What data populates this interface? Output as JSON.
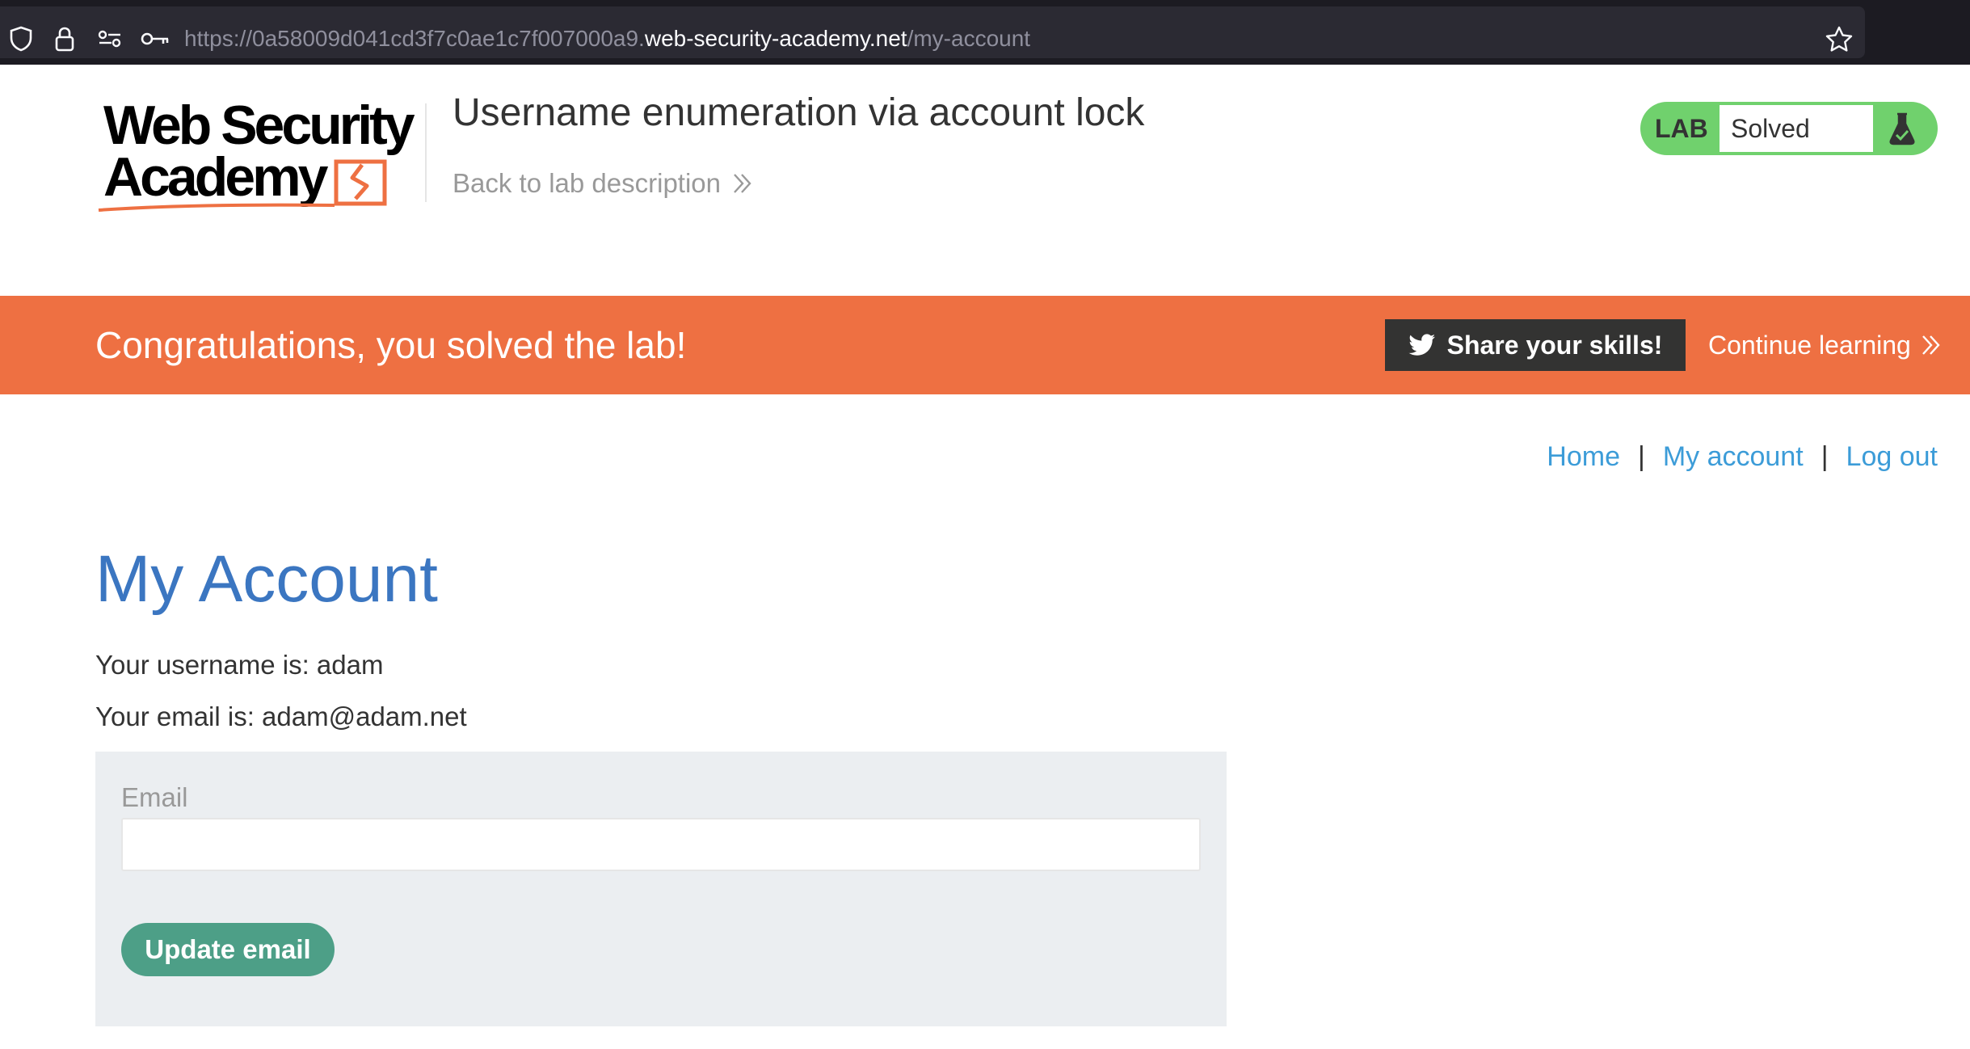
{
  "browser": {
    "url_prefix": "https://0a58009d041cd3f7c0ae1c7f007000a9.",
    "url_host": "web-security-academy.net",
    "url_path": "/my-account"
  },
  "header": {
    "logo_line1": "Web Security",
    "logo_line2": "Academy",
    "lab_title": "Username enumeration via account lock",
    "back_link": "Back to lab description",
    "lab_tag": "LAB",
    "lab_status": "Solved"
  },
  "banner": {
    "message": "Congratulations, you solved the lab!",
    "share_label": "Share your skills!",
    "continue_label": "Continue learning"
  },
  "nav": {
    "home": "Home",
    "my_account": "My account",
    "log_out": "Log out",
    "separator": "|"
  },
  "account": {
    "title": "My Account",
    "username_line": "Your username is: adam",
    "email_line": "Your email is: adam@adam.net"
  },
  "form": {
    "email_label": "Email",
    "email_value": "",
    "submit_label": "Update email"
  },
  "colors": {
    "banner": "#ee7042",
    "title": "#3b76c1",
    "link": "#3c9cd8",
    "button": "#4d9f87",
    "status": "#70d16d"
  }
}
